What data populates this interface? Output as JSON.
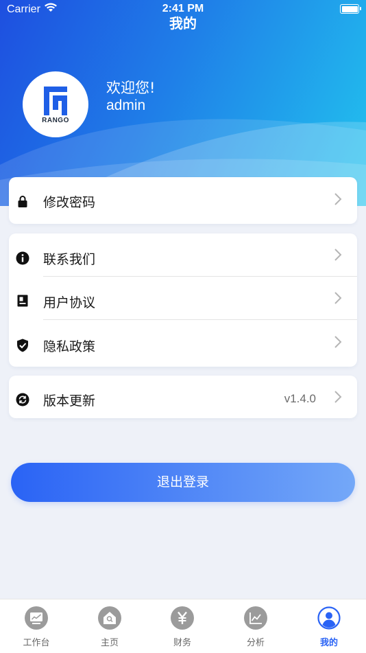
{
  "status_bar": {
    "carrier": "Carrier",
    "time": "2:41 PM"
  },
  "header": {
    "title": "我的",
    "welcome": "欢迎您!",
    "username": "admin",
    "brand": "RANGO"
  },
  "menu": {
    "change_password": "修改密码",
    "contact_us": "联系我们",
    "user_agreement": "用户协议",
    "privacy_policy": "隐私政策",
    "version_update": "版本更新",
    "version_value": "v1.4.0"
  },
  "logout_label": "退出登录",
  "tabs": [
    {
      "label": "工作台",
      "icon": "monitor-chart-icon"
    },
    {
      "label": "主页",
      "icon": "home-search-icon"
    },
    {
      "label": "财务",
      "icon": "yuan-icon"
    },
    {
      "label": "分析",
      "icon": "line-chart-icon"
    },
    {
      "label": "我的",
      "icon": "user-icon"
    }
  ],
  "colors": {
    "accent": "#2a63f5",
    "header_start": "#1e4fe0",
    "header_end": "#22c4ee",
    "inactive_tab": "#9b9b9b"
  }
}
